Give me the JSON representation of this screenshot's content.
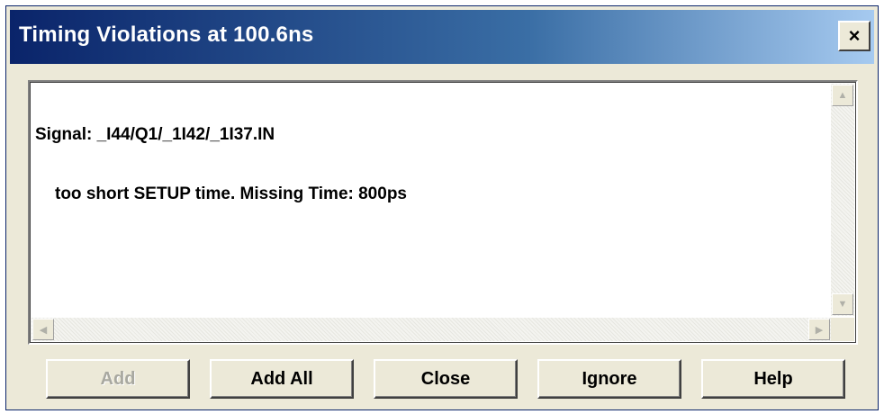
{
  "window": {
    "title": "Timing Violations at 100.6ns",
    "close_label": "×"
  },
  "list": {
    "lines": [
      "Signal: _I44/Q1/_1I42/_1I37.IN",
      "too short SETUP time. Missing Time: 800ps"
    ]
  },
  "icons": {
    "scroll_up": "▲",
    "scroll_down": "▼",
    "scroll_left": "◀",
    "scroll_right": "▶"
  },
  "buttons": {
    "add": "Add",
    "add_all": "Add All",
    "close": "Close",
    "ignore": "Ignore",
    "help": "Help"
  }
}
